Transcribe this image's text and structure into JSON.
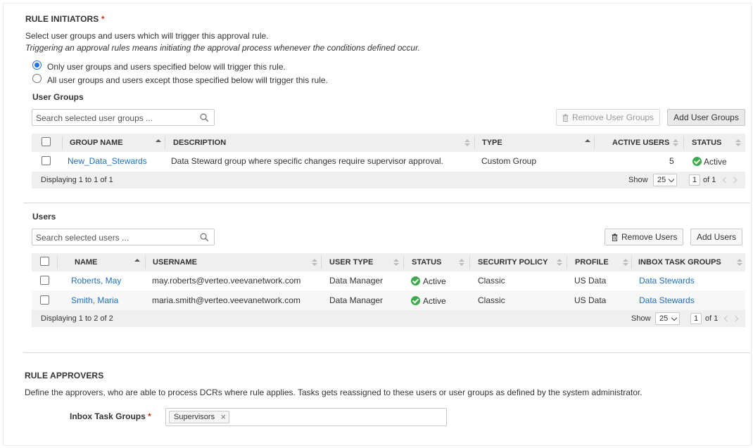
{
  "initiators": {
    "title": "RULE INITIATORS",
    "required_mark": "*",
    "description": "Select user groups and users which will trigger this approval rule.",
    "note": "Triggering an approval rules means initiating the approval process whenever the conditions defined occur.",
    "radio_options": [
      {
        "label": "Only user groups and users specified below will trigger this rule.",
        "selected": true
      },
      {
        "label": "All user groups and users except those specified below will trigger this rule.",
        "selected": false
      }
    ]
  },
  "user_groups": {
    "title": "User Groups",
    "search_placeholder": "Search selected user groups ...",
    "remove_button": "Remove User Groups",
    "add_button": "Add User Groups",
    "columns": [
      "GROUP NAME",
      "DESCRIPTION",
      "TYPE",
      "ACTIVE USERS",
      "STATUS"
    ],
    "rows": [
      {
        "name": "New_Data_Stewards",
        "description": "Data Steward group where specific changes require supervisor approval.",
        "type": "Custom Group",
        "active_users": "5",
        "status": "Active"
      }
    ],
    "footer": {
      "displaying": "Displaying 1 to 1 of 1",
      "show_label": "Show",
      "page_size": "25",
      "page": "1",
      "of_pages": "of 1"
    }
  },
  "users": {
    "title": "Users",
    "search_placeholder": "Search selected users ...",
    "remove_button": "Remove Users",
    "add_button": "Add Users",
    "columns": [
      "NAME",
      "USERNAME",
      "USER TYPE",
      "STATUS",
      "SECURITY POLICY",
      "PROFILE",
      "INBOX TASK GROUPS"
    ],
    "rows": [
      {
        "name": "Roberts, May",
        "username": "may.roberts@verteo.veevanetwork.com",
        "user_type": "Data Manager",
        "status": "Active",
        "security_policy": "Classic",
        "profile": "US Data",
        "inbox_task_groups": "Data Stewards"
      },
      {
        "name": "Smith, Maria",
        "username": "maria.smith@verteo.veevanetwork.com",
        "user_type": "Data Manager",
        "status": "Active",
        "security_policy": "Classic",
        "profile": "US Data",
        "inbox_task_groups": "Data Stewards"
      }
    ],
    "footer": {
      "displaying": "Displaying 1 to 2 of 2",
      "show_label": "Show",
      "page_size": "25",
      "page": "1",
      "of_pages": "of 1"
    }
  },
  "approvers": {
    "title": "RULE APPROVERS",
    "description": "Define the approvers, who are able to process DCRs where rule applies. Tasks gets reassigned to these users or user groups as defined by the system administrator.",
    "field_label": "Inbox Task Groups",
    "required_mark": "*",
    "tags": [
      "Supervisors"
    ]
  },
  "colors": {
    "link": "#1f6fbf",
    "active_status": "#3daa4c",
    "required": "#c0392b",
    "radio_selected": "#1a73e8"
  }
}
